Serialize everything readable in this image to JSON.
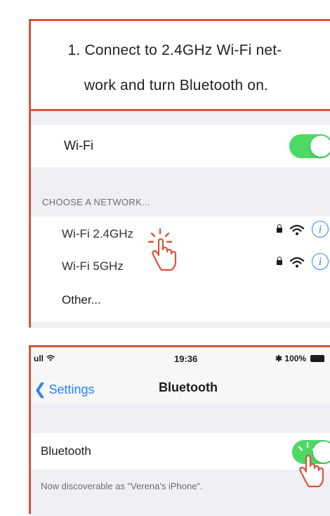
{
  "step1": {
    "line1": "1. Connect to 2.4GHz Wi-Fi net-",
    "line2": "work and turn Bluetooth on."
  },
  "wifi_settings": {
    "wifi_label": "Wi-Fi",
    "wifi_on": true,
    "section_header": "CHOOSE A NETWORK...",
    "networks": [
      {
        "name": "Wi-Fi 2.4GHz",
        "locked": true,
        "info_icon": "i"
      },
      {
        "name": "Wi-Fi 5GHz",
        "locked": true,
        "info_icon": "i"
      }
    ],
    "other_label": "Other..."
  },
  "bluetooth_settings": {
    "status_bar": {
      "signal": "ull",
      "time": "19:36",
      "battery": "✱ 100%"
    },
    "back_label": "Settings",
    "title": "Bluetooth",
    "bluetooth_label": "Bluetooth",
    "bluetooth_on": true,
    "discoverable_note": "Now discoverable as \"Verena's iPhone\"."
  },
  "colors": {
    "frame": "#d9533b",
    "toggle_on": "#4cd964",
    "ios_blue": "#2a83f7",
    "group_bg": "#efeff4"
  },
  "icons": [
    "hand-pointer-icon",
    "lock-icon",
    "wifi-icon",
    "info-icon",
    "chevron-left-icon",
    "battery-icon",
    "bluetooth-icon"
  ]
}
